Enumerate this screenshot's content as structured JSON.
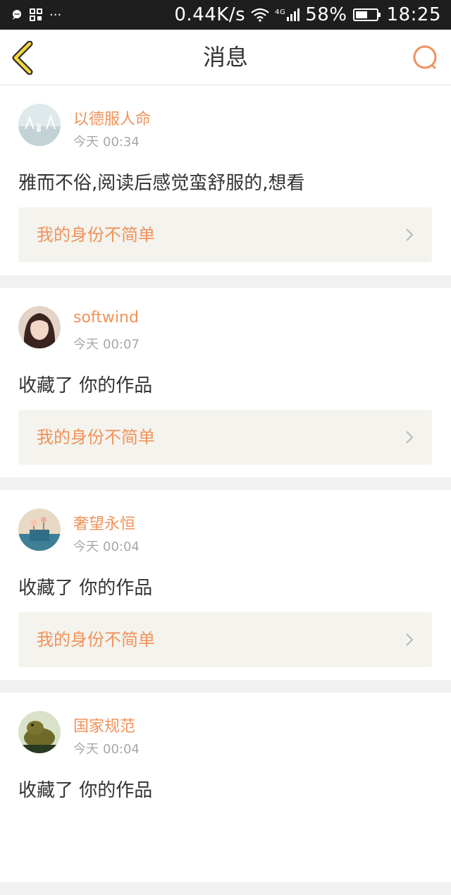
{
  "status_bar": {
    "left_icons": [
      "chat-bubble-icon",
      "app-grid-icon",
      "more-icon"
    ],
    "more": "···",
    "speed": "0.44K/s",
    "network": "4G",
    "battery": "58%",
    "battery_level": 0.58,
    "time": "18:25"
  },
  "header": {
    "title": "消息",
    "back_icon": "chevron-left-icon",
    "search_icon": "search-icon",
    "accent_color": "#f0925a"
  },
  "messages": [
    {
      "username": "以德服人命",
      "day": "今天",
      "time": "00:34",
      "content": "雅而不俗,阅读后感觉蛮舒服的,想看",
      "work_title": "我的身份不简单"
    },
    {
      "username": "softwind",
      "day": "今天",
      "time": "00:07",
      "content": "收藏了 你的作品",
      "work_title": "我的身份不简单"
    },
    {
      "username": "奢望永恒",
      "day": "今天",
      "time": "00:04",
      "content": "收藏了 你的作品",
      "work_title": "我的身份不简单"
    },
    {
      "username": "国家规范",
      "day": "今天",
      "time": "00:04",
      "content": "收藏了 你的作品",
      "work_title": ""
    }
  ]
}
